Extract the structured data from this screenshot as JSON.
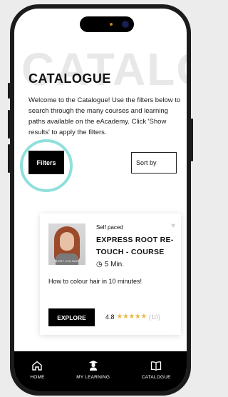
{
  "background_word": "CATALOG",
  "page": {
    "title": "CATALOGUE",
    "description": "Welcome to the Catalogue! Use the filters below to search through the many courses and learning paths available on the eAcademy. Click 'Show results' to apply the filters."
  },
  "controls": {
    "filters_label": "Filters",
    "sort_label": "Sort by"
  },
  "course": {
    "pace": "Self paced",
    "title": "EXPRESS ROOT RE-TOUCH - COURSE",
    "duration": "5 Min.",
    "tagline": "How to colour hair in 10 minutes!",
    "thumb_caption": "ROOT COLOUR",
    "explore_label": "EXPLORE",
    "rating_value": "4.8",
    "rating_stars": 5,
    "rating_count": "(10)"
  },
  "nav": {
    "items": [
      {
        "label": "HOME",
        "icon": "home-icon"
      },
      {
        "label": "MY LEARNING",
        "icon": "graduate-icon"
      },
      {
        "label": "CATALOGUE",
        "icon": "book-icon"
      }
    ]
  },
  "colors": {
    "accent_ring": "#8fe0dc",
    "star": "#e8b84a",
    "primary": "#000000"
  }
}
